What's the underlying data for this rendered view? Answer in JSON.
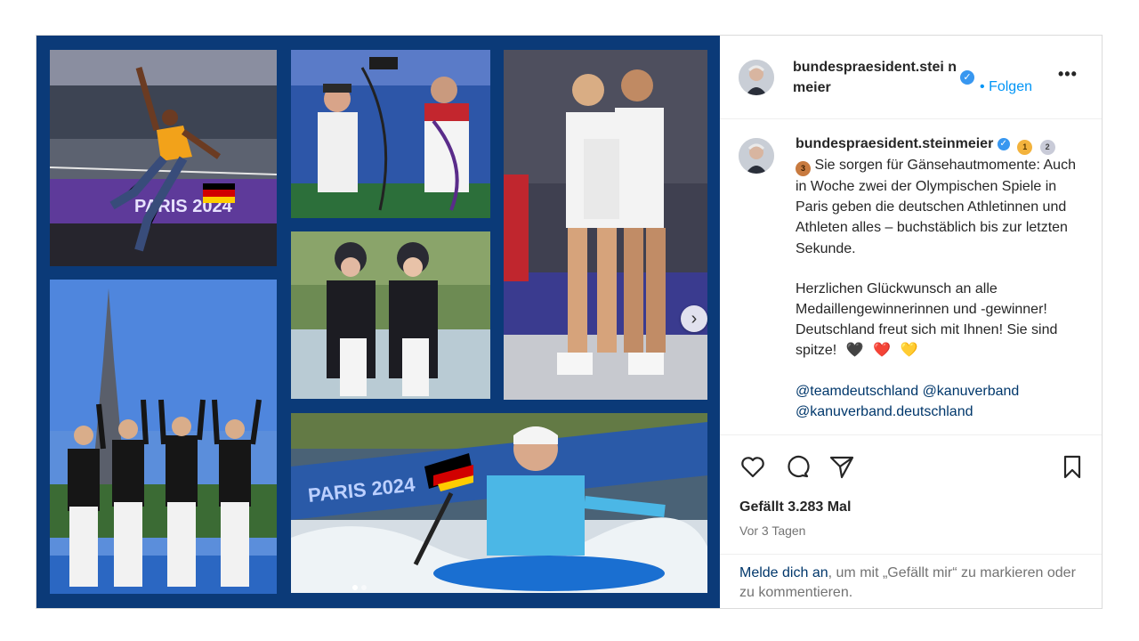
{
  "post": {
    "username": "bundespraesident.steinmeier",
    "username_wrapped": "bundespraesident.stei nmeier",
    "follow_label": "Folgen",
    "follow_separator": "•",
    "more_label": "•••",
    "verified_glyph": "✓"
  },
  "caption": {
    "username": "bundespraesident.steinmeier",
    "medals": [
      "1",
      "2",
      "3"
    ],
    "text_1": "Sie sorgen für Gänsehautmomente: Auch in Woche zwei der Olympischen Spiele in Paris geben die deutschen Athletinnen und Athleten alles – buchstäblich bis zur letzten Sekunde.",
    "text_2": "Herzlichen Glückwunsch an alle Medaillengewinnerinnen und -gewinner! Deutschland freut sich mit Ihnen! Sie sind spitze!",
    "hearts": [
      "🖤",
      "❤️",
      "💛"
    ],
    "mentions": [
      "@teamdeutschland",
      "@kanuverband",
      "@kanuverband.deutschland"
    ]
  },
  "media": {
    "images": [
      {
        "id": "athletics-jump",
        "desc": "hurdler"
      },
      {
        "id": "archery",
        "desc": "archery"
      },
      {
        "id": "dressage",
        "desc": "riders"
      },
      {
        "id": "basketball",
        "desc": "team celebration"
      },
      {
        "id": "eiffel-team",
        "desc": "team podium"
      },
      {
        "id": "canoe-slalom",
        "desc": "kayak"
      }
    ],
    "next_glyph": "›",
    "dots": 2
  },
  "stats": {
    "likes": "Gefällt 3.283 Mal",
    "time_ago": "Vor 3 Tagen"
  },
  "login": {
    "link": "Melde dich an",
    "rest": ", um mit „Gefällt mir“ zu markieren oder zu kommentieren."
  },
  "colors": {
    "accent": "#0095f6",
    "link": "#00376b",
    "collage_bg": "#0b3a78"
  }
}
